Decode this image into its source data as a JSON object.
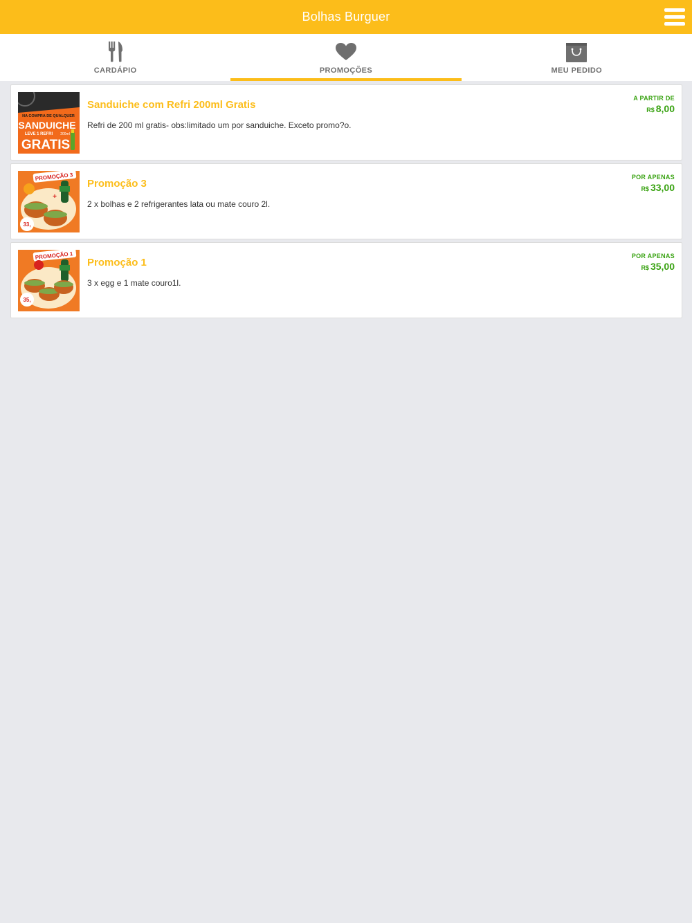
{
  "header": {
    "title": "Bolhas Burguer",
    "menu_icon": "hamburger-menu-icon"
  },
  "tabs": [
    {
      "label": "CARDÁPIO",
      "icon": "fork-knife-icon",
      "active": false
    },
    {
      "label": "PROMOÇÕES",
      "icon": "heart-icon",
      "active": true
    },
    {
      "label": "MEU PEDIDO",
      "icon": "shopping-bag-icon",
      "active": false
    }
  ],
  "colors": {
    "brand": "#fcbd1a",
    "price": "#3aa313",
    "background": "#e8e9ed"
  },
  "promotions": [
    {
      "name": "Sanduiche com Refri 200ml Gratis",
      "description": "Refri de 200 ml gratis- obs:limitado um por sanduiche. Exceto promo?o.",
      "price_prefix": "A PARTIR DE",
      "currency": "R$",
      "price": "8,00",
      "image": {
        "line1": "NA COMPRA DE QUALQUER",
        "line2": "SANDUICHE",
        "line3": "LEVE 1 REFRI",
        "line3b": "200ml",
        "line4": "GRATIS"
      }
    },
    {
      "name": "Promoção 3",
      "description": "2 x bolhas e 2 refrigerantes lata ou mate couro 2l.",
      "price_prefix": "POR APENAS",
      "currency": "R$",
      "price": "33,00",
      "image": {
        "banner": "PROMOÇÃO 3",
        "badge": "33,"
      }
    },
    {
      "name": "Promoção 1",
      "description": "3 x egg e 1 mate couro1l.",
      "price_prefix": "POR APENAS",
      "currency": "R$",
      "price": "35,00",
      "image": {
        "banner": "PROMOÇÃO 1",
        "badge": "35,"
      }
    }
  ]
}
